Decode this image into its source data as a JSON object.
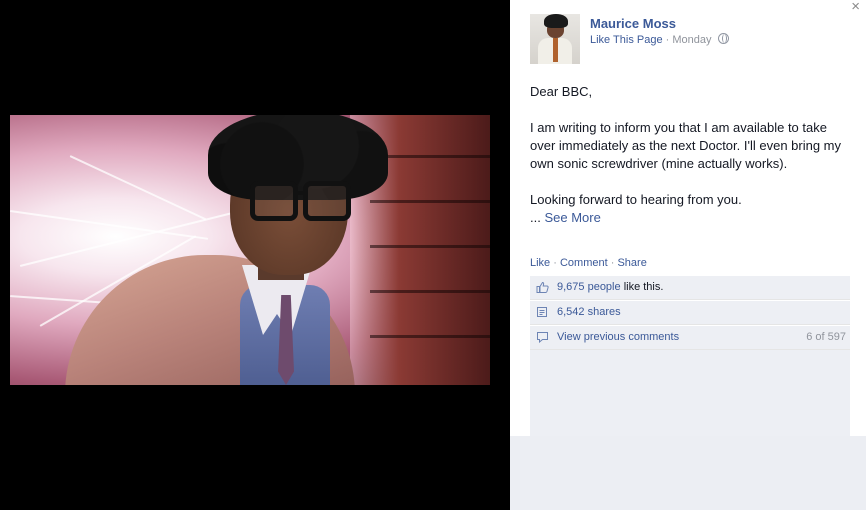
{
  "post": {
    "author": "Maurice Moss",
    "like_page": "Like This Page",
    "separator": "·",
    "time": "Monday",
    "greeting": "Dear BBC,",
    "body": "I am writing to inform you that I am available to take over immediately as the next Doctor. I'll even bring my own sonic screwdriver (mine actually works).",
    "closing": "Looking forward to hearing from you.",
    "ellipsis": "...",
    "see_more": "See More"
  },
  "actions": {
    "like": "Like",
    "comment": "Comment",
    "share": "Share",
    "sep": "·"
  },
  "ufi": {
    "likes_count": "9,675 people",
    "likes_suffix": "like this.",
    "shares": "6,542 shares",
    "view_previous": "View previous comments",
    "comment_count": "6 of 597"
  },
  "window": {
    "close": "×"
  },
  "icons": {
    "close": "close-icon",
    "privacy": "globe-icon",
    "like": "thumbs-up-icon",
    "share": "share-icon",
    "comments": "comment-bubble-icon"
  },
  "colors": {
    "link": "#3b5998",
    "meta": "#90949c",
    "ufi_bg": "#edeff4",
    "viewer_bg": "#000000"
  }
}
